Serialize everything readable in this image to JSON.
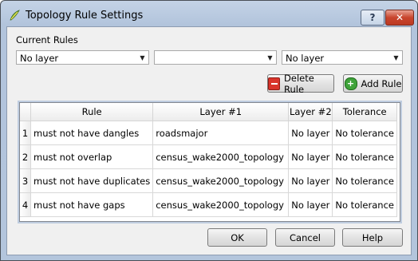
{
  "window": {
    "title": "Topology Rule Settings"
  },
  "labels": {
    "current_rules": "Current Rules"
  },
  "selectors": {
    "layer1": "No layer",
    "rule": "",
    "layer2": "No layer"
  },
  "buttons": {
    "delete_rule": "Delete Rule",
    "add_rule": "Add Rule",
    "ok": "OK",
    "cancel": "Cancel",
    "help": "Help"
  },
  "table": {
    "headers": [
      "Rule",
      "Layer #1",
      "Layer #2",
      "Tolerance"
    ],
    "rows": [
      {
        "num": "1",
        "rule": "must not have dangles",
        "layer1": "roadsmajor",
        "layer2": "No layer",
        "tolerance": "No tolerance"
      },
      {
        "num": "2",
        "rule": "must not overlap",
        "layer1": "census_wake2000_topology",
        "layer2": "No layer",
        "tolerance": "No tolerance"
      },
      {
        "num": "3",
        "rule": "must not have duplicates",
        "layer1": "census_wake2000_topology",
        "layer2": "No layer",
        "tolerance": "No tolerance"
      },
      {
        "num": "4",
        "rule": "must not have gaps",
        "layer1": "census_wake2000_topology",
        "layer2": "No layer",
        "tolerance": "No tolerance"
      }
    ]
  }
}
